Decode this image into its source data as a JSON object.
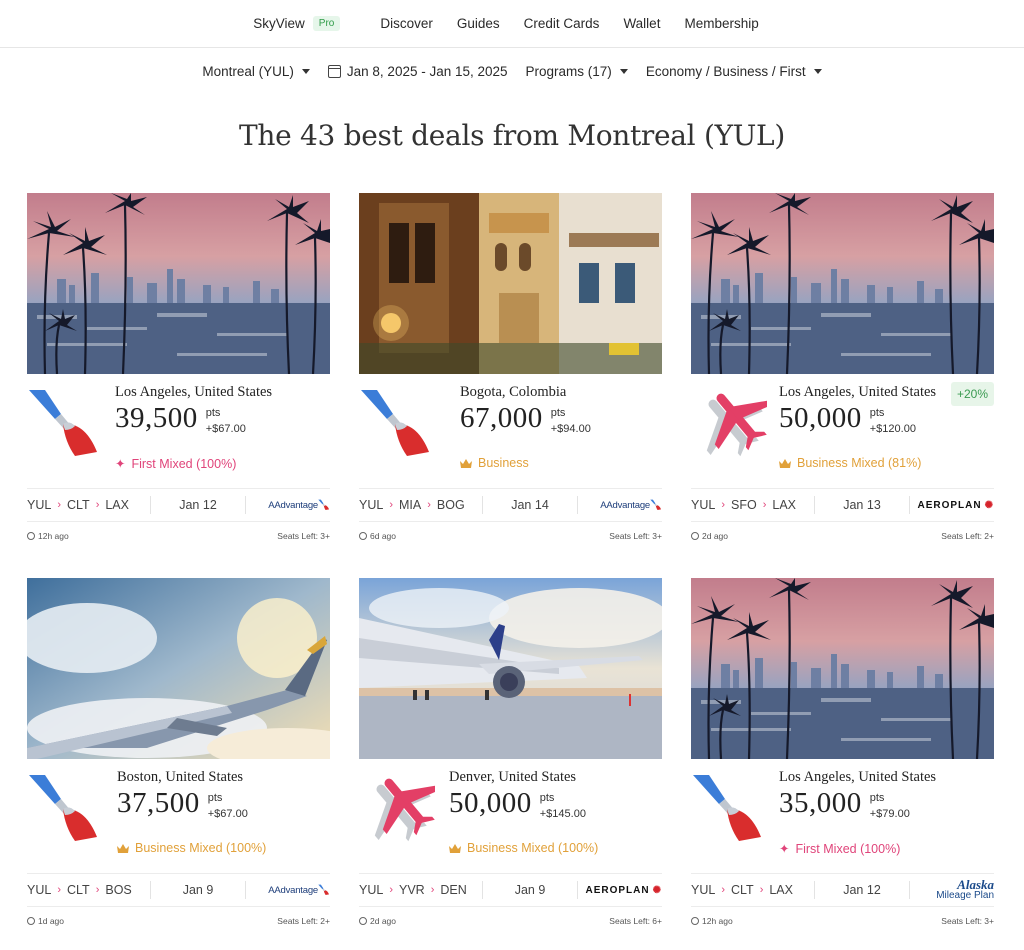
{
  "nav": {
    "brand": "SkyView",
    "pro": "Pro",
    "links": [
      "Discover",
      "Guides",
      "Credit Cards",
      "Wallet",
      "Membership"
    ]
  },
  "filters": {
    "origin": "Montreal (YUL)",
    "dates": "Jan 8, 2025 - Jan 15, 2025",
    "programs": "Programs (17)",
    "cabins": "Economy / Business / First"
  },
  "heading": "The 43 best deals from Montreal (YUL)",
  "cards": [
    {
      "city": "Los Angeles, United States",
      "points": "39,500",
      "pts": "pts",
      "tax": "+$67.00",
      "cabin": "First Mixed (100%)",
      "cabin_type": "first",
      "route": [
        "YUL",
        "CLT",
        "LAX"
      ],
      "date": "Jan 12",
      "program": "AAdvantage",
      "program_small": "American Airlines",
      "ago": "12h ago",
      "seats": "Seats Left: 3+",
      "badge": ""
    },
    {
      "city": "Bogota, Colombia",
      "points": "67,000",
      "pts": "pts",
      "tax": "+$94.00",
      "cabin": "Business",
      "cabin_type": "business",
      "route": [
        "YUL",
        "MIA",
        "BOG"
      ],
      "date": "Jan 14",
      "program": "AAdvantage",
      "program_small": "American Airlines",
      "ago": "6d ago",
      "seats": "Seats Left: 3+",
      "badge": ""
    },
    {
      "city": "Los Angeles, United States",
      "points": "50,000",
      "pts": "pts",
      "tax": "+$120.00",
      "cabin": "Business Mixed (81%)",
      "cabin_type": "business",
      "route": [
        "YUL",
        "SFO",
        "LAX"
      ],
      "date": "Jan 13",
      "program": "AEROPLAN",
      "ago": "2d ago",
      "seats": "Seats Left: 2+",
      "badge": "+20%"
    },
    {
      "city": "Boston, United States",
      "points": "37,500",
      "pts": "pts",
      "tax": "+$67.00",
      "cabin": "Business Mixed (100%)",
      "cabin_type": "business",
      "route": [
        "YUL",
        "CLT",
        "BOS"
      ],
      "date": "Jan 9",
      "program": "AAdvantage",
      "program_small": "American Airlines",
      "ago": "1d ago",
      "seats": "Seats Left: 2+",
      "badge": ""
    },
    {
      "city": "Denver, United States",
      "points": "50,000",
      "pts": "pts",
      "tax": "+$145.00",
      "cabin": "Business Mixed (100%)",
      "cabin_type": "business",
      "route": [
        "YUL",
        "YVR",
        "DEN"
      ],
      "date": "Jan 9",
      "program": "AEROPLAN",
      "ago": "2d ago",
      "seats": "Seats Left: 6+",
      "badge": ""
    },
    {
      "city": "Los Angeles, United States",
      "points": "35,000",
      "pts": "pts",
      "tax": "+$79.00",
      "cabin": "First Mixed (100%)",
      "cabin_type": "first",
      "route": [
        "YUL",
        "CLT",
        "LAX"
      ],
      "date": "Jan 12",
      "program": "Alaska",
      "program_small": "Mileage Plan",
      "ago": "12h ago",
      "seats": "Seats Left: 3+",
      "badge": ""
    }
  ]
}
